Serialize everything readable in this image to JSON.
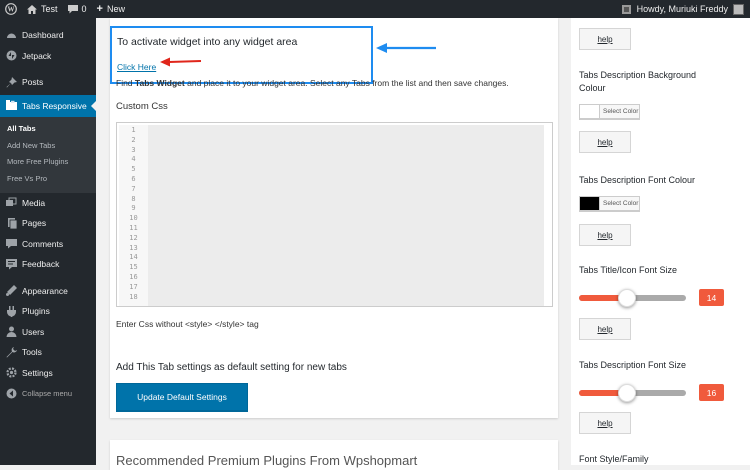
{
  "adminbar": {
    "site_name": "Test",
    "comments_count": "0",
    "new_label": "New",
    "howdy": "Howdy, Muriuki Freddy"
  },
  "sidebar": {
    "items": [
      {
        "label": "Dashboard",
        "icon": "dashboard-icon"
      },
      {
        "label": "Jetpack",
        "icon": "jetpack-icon"
      },
      {
        "label": "Posts",
        "icon": "pin-icon"
      },
      {
        "label": "Tabs Responsive",
        "icon": "tabs-icon"
      },
      {
        "label": "Media",
        "icon": "media-icon"
      },
      {
        "label": "Pages",
        "icon": "pages-icon"
      },
      {
        "label": "Comments",
        "icon": "comments-icon"
      },
      {
        "label": "Feedback",
        "icon": "feedback-icon"
      },
      {
        "label": "Appearance",
        "icon": "appearance-icon"
      },
      {
        "label": "Plugins",
        "icon": "plugins-icon"
      },
      {
        "label": "Users",
        "icon": "users-icon"
      },
      {
        "label": "Tools",
        "icon": "tools-icon"
      },
      {
        "label": "Settings",
        "icon": "settings-icon"
      },
      {
        "label": "Collapse menu",
        "icon": "collapse-icon"
      }
    ],
    "submenu": [
      "All Tabs",
      "Add New Tabs",
      "More Free Plugins",
      "Free Vs Pro"
    ]
  },
  "main": {
    "notice_title": "To activate widget into any widget area",
    "notice_link": "Click Here",
    "find_prefix": "Find",
    "find_bold": "Tabs Widget",
    "find_suffix": "and place it to your widget area. Select any Tabs from the list and then save changes.",
    "custom_css_label": "Custom Css",
    "line_numbers": [
      "1",
      "2",
      "3",
      "4",
      "5",
      "6",
      "7",
      "8",
      "9",
      "10",
      "11",
      "12",
      "13",
      "14",
      "15",
      "16",
      "17",
      "18"
    ],
    "css_hint": "Enter Css without <style> </style> tag",
    "default_label": "Add This Tab settings as default setting for new tabs",
    "update_button": "Update Default Settings",
    "recommended_title": "Recommended Premium Plugins From Wpshopmart"
  },
  "right": {
    "help_label": "help",
    "desc_bg_label": "Tabs Description Background Colour",
    "desc_font_colour_label": "Tabs Description Font Colour",
    "select_color": "Select Color",
    "title_font_size_label": "Tabs Title/Icon Font Size",
    "title_font_size_value": "14",
    "desc_font_size_label": "Tabs Description Font Size",
    "desc_font_size_value": "16",
    "font_style_label": "Font Style/Family",
    "colors": {
      "desc_bg": "#ffffff",
      "desc_font": "#000000",
      "accent": "#f05a3c"
    },
    "title_slider_level": 0.45,
    "desc_slider_level": 0.45
  }
}
